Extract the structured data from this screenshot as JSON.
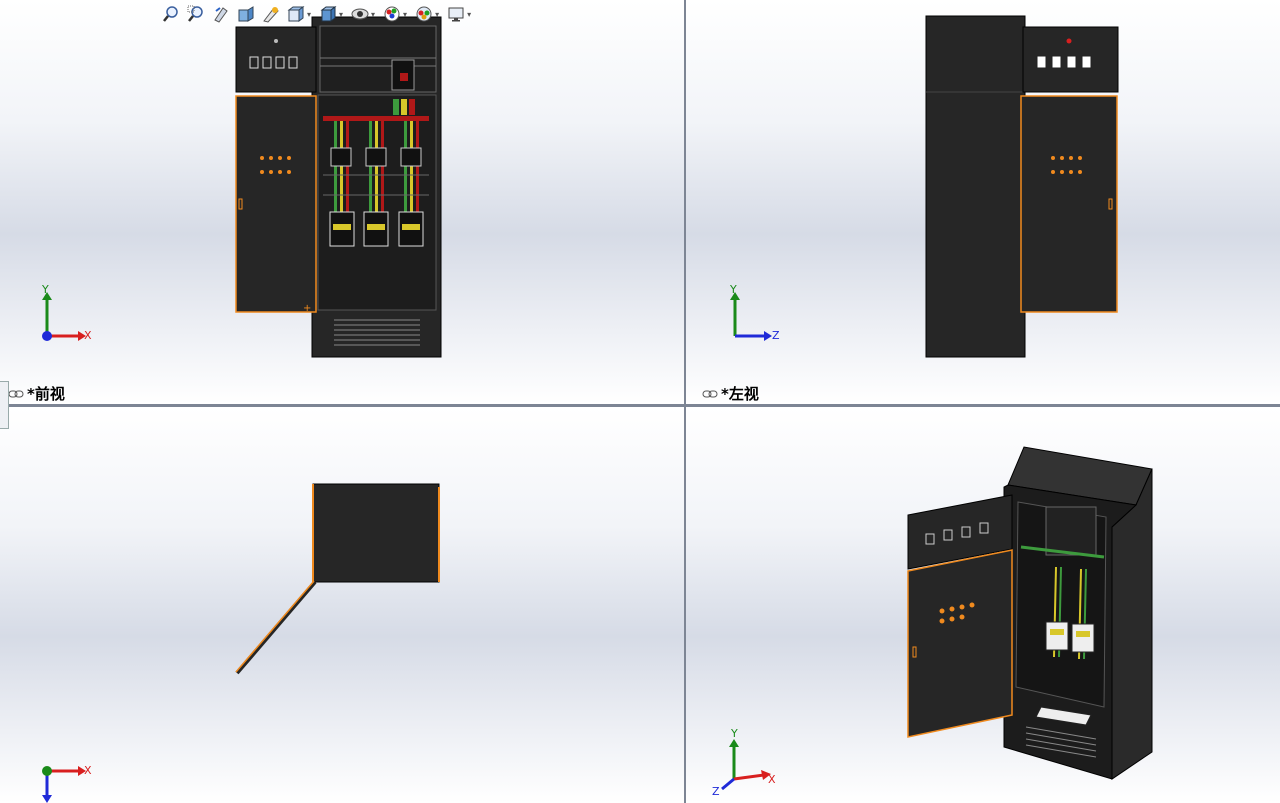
{
  "views": {
    "front": {
      "label": "*前视"
    },
    "left": {
      "label": "*左视"
    },
    "top": {
      "label": ""
    },
    "iso": {
      "label": ""
    }
  },
  "triad": {
    "x": "X",
    "y": "Y",
    "z": "Z"
  },
  "toolbar": {
    "buttons": [
      {
        "name": "zoom-to-fit-icon"
      },
      {
        "name": "zoom-to-area-icon"
      },
      {
        "name": "previous-view-icon"
      },
      {
        "name": "section-view-icon"
      },
      {
        "name": "dynamic-annotation-icon"
      },
      {
        "name": "view-orientation-icon"
      },
      {
        "name": "display-style-icon"
      },
      {
        "name": "hide-show-items-icon"
      },
      {
        "name": "edit-appearance-icon"
      },
      {
        "name": "apply-scene-icon"
      },
      {
        "name": "view-settings-icon"
      }
    ]
  },
  "colors": {
    "cabinet": "#262626",
    "edge": "#000000",
    "door_highlight": "#f08a1e",
    "busbar": "#b01818",
    "wire_green": "#3d9b3d",
    "wire_yellow": "#d8c72a",
    "axis_x": "#d81f1f",
    "axis_y": "#1a8a1a",
    "axis_z": "#1f2ad8"
  }
}
